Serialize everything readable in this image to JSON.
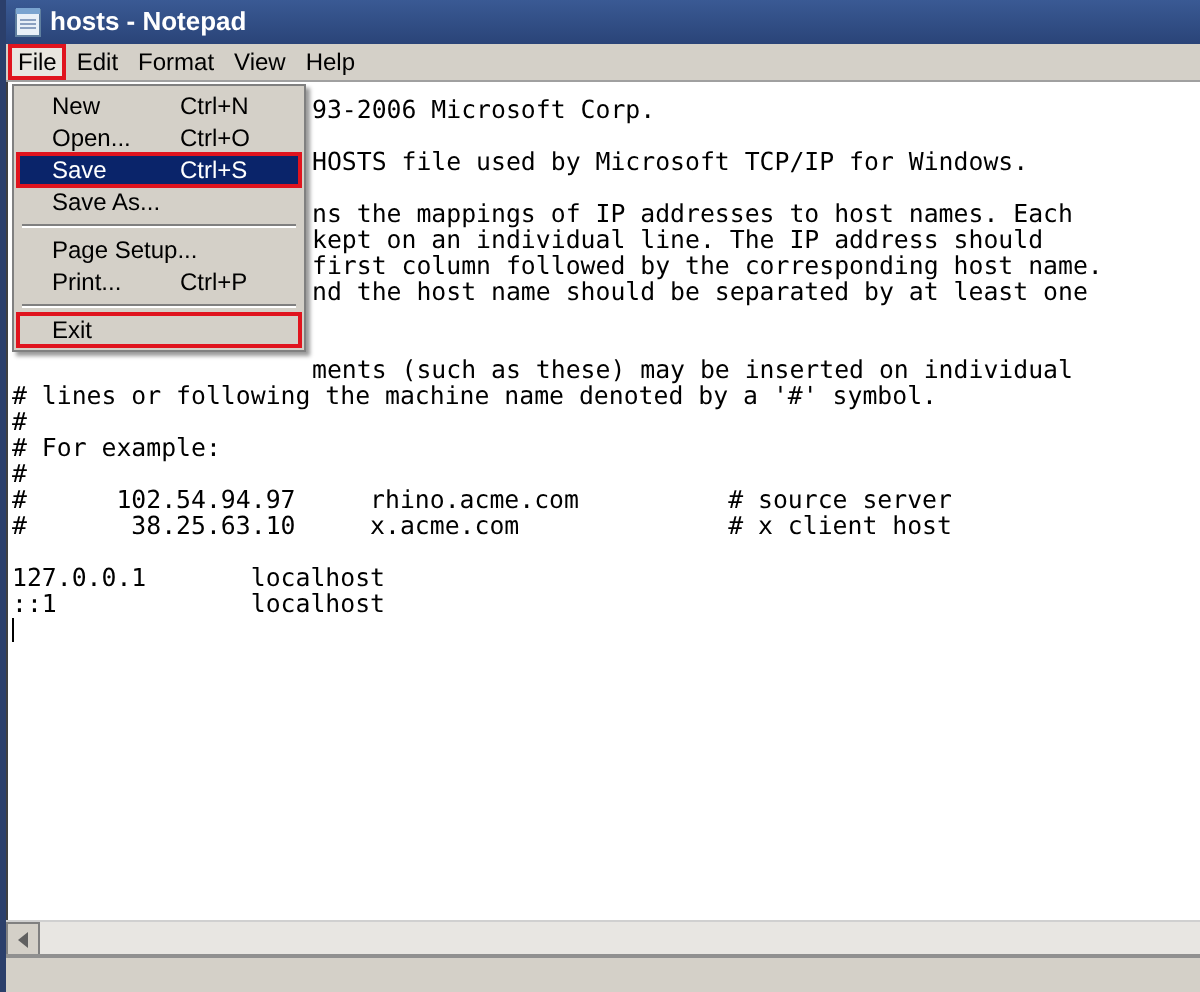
{
  "window": {
    "title": "hosts - Notepad"
  },
  "menu_bar": [
    {
      "label": "File",
      "selected": true,
      "annotated": true
    },
    {
      "label": "Edit",
      "selected": false,
      "annotated": false
    },
    {
      "label": "Format",
      "selected": false,
      "annotated": false
    },
    {
      "label": "View",
      "selected": false,
      "annotated": false
    },
    {
      "label": "Help",
      "selected": false,
      "annotated": false
    }
  ],
  "file_menu": [
    {
      "kind": "item",
      "label": "New",
      "shortcut": "Ctrl+N",
      "selected": false,
      "annotated": false
    },
    {
      "kind": "item",
      "label": "Open...",
      "shortcut": "Ctrl+O",
      "selected": false,
      "annotated": false
    },
    {
      "kind": "item",
      "label": "Save",
      "shortcut": "Ctrl+S",
      "selected": true,
      "annotated": true
    },
    {
      "kind": "item",
      "label": "Save As...",
      "selected": false,
      "annotated": false
    },
    {
      "kind": "separator"
    },
    {
      "kind": "item",
      "label": "Page Setup...",
      "selected": false,
      "annotated": false
    },
    {
      "kind": "item",
      "label": "Print...",
      "shortcut": "Ctrl+P",
      "selected": false,
      "annotated": false
    },
    {
      "kind": "separator"
    },
    {
      "kind": "item",
      "label": "Exit",
      "selected": false,
      "annotated": true
    }
  ],
  "editor_lines": [
    {
      "kind": "partial",
      "text": "93-2006 Microsoft Corp."
    },
    {
      "kind": "blank"
    },
    {
      "kind": "partial",
      "text": "HOSTS file used by Microsoft TCP/IP for Windows."
    },
    {
      "kind": "blank"
    },
    {
      "kind": "partial",
      "text": "ns the mappings of IP addresses to host names. Each"
    },
    {
      "kind": "partial",
      "text": "kept on an individual line. The IP address should"
    },
    {
      "kind": "partial",
      "text": "first column followed by the corresponding host name."
    },
    {
      "kind": "partial",
      "text": "nd the host name should be separated by at least one"
    },
    {
      "kind": "blank"
    },
    {
      "kind": "blank"
    },
    {
      "kind": "partial",
      "text": "ments (such as these) may be inserted on individual"
    },
    {
      "kind": "full",
      "text": "# lines or following the machine name denoted by a '#' symbol."
    },
    {
      "kind": "full",
      "text": "#"
    },
    {
      "kind": "full",
      "text": "# For example:"
    },
    {
      "kind": "full",
      "text": "#"
    },
    {
      "kind": "full",
      "text": "#      102.54.94.97     rhino.acme.com          # source server"
    },
    {
      "kind": "full",
      "text": "#       38.25.63.10     x.acme.com              # x client host"
    },
    {
      "kind": "blank"
    },
    {
      "kind": "full",
      "text": "127.0.0.1       localhost"
    },
    {
      "kind": "full",
      "text": "::1             localhost"
    },
    {
      "kind": "cursor"
    }
  ]
}
